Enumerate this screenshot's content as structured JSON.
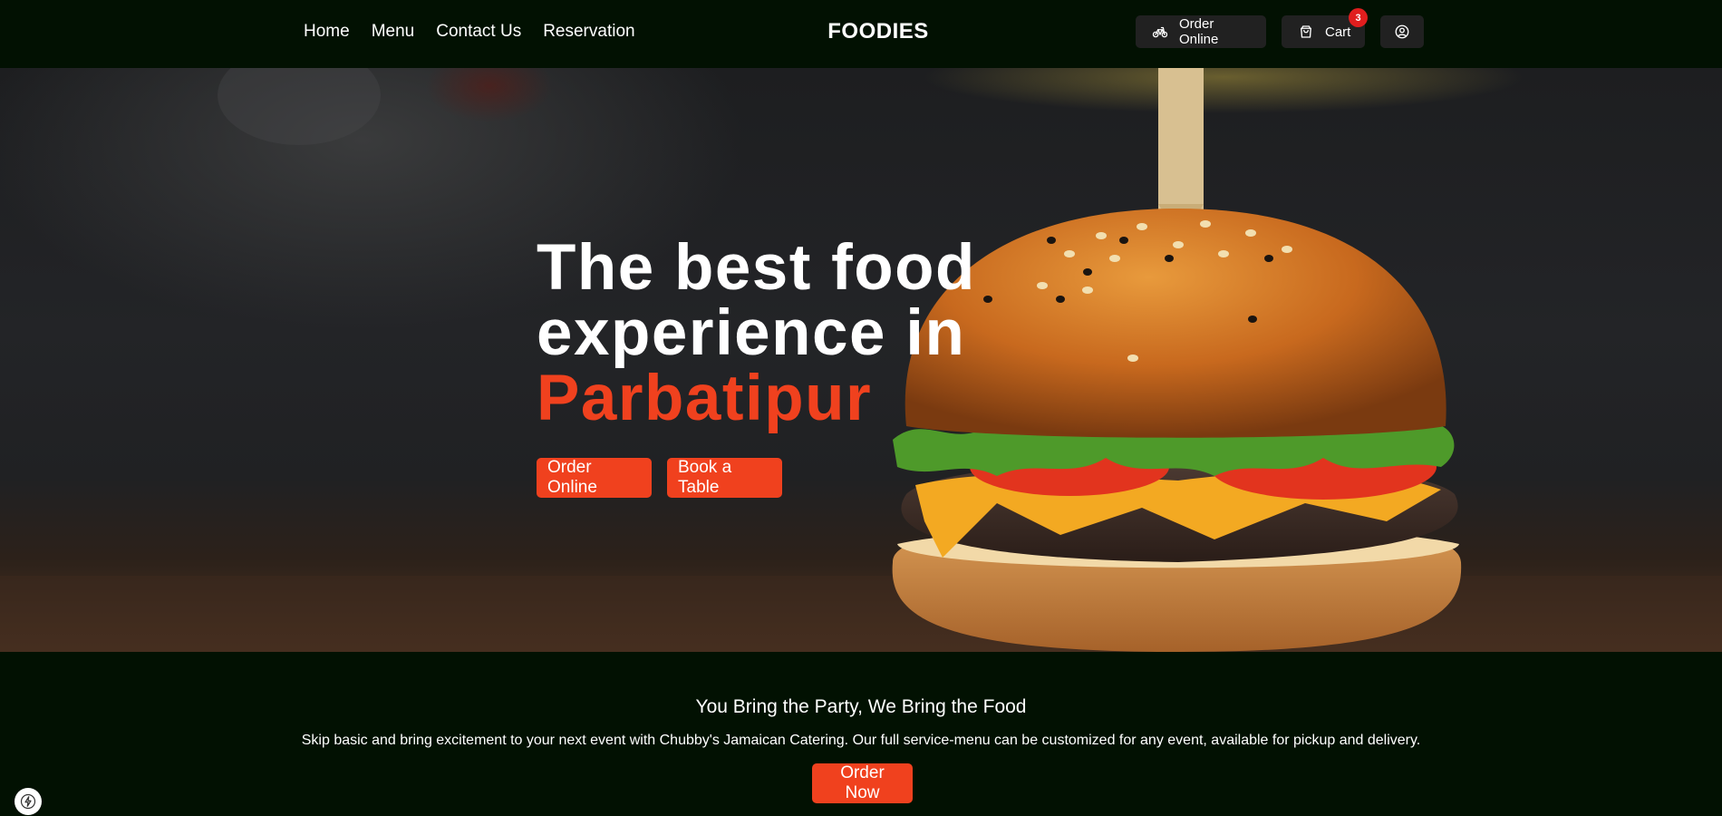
{
  "nav": {
    "links": [
      "Home",
      "Menu",
      "Contact Us",
      "Reservation"
    ],
    "brand": "FOODIES",
    "order_online_label": "Order Online",
    "cart_label": "Cart",
    "cart_count": "3",
    "icons": {
      "order": "bicycle-icon",
      "cart": "shopping-bag-icon",
      "profile": "user-circle-icon"
    }
  },
  "hero": {
    "title_line1": "The best food",
    "title_line2": "experience in",
    "title_accent": "Parbatipur",
    "primary_button": "Order Online",
    "secondary_button": "Book a Table"
  },
  "promo": {
    "title": "You Bring the Party, We Bring the Food",
    "text": "Skip basic and bring excitement to your next event with Chubby's Jamaican Catering. Our full service-menu can be customized for any event, available for pickup and delivery.",
    "button": "Order Now"
  },
  "colors": {
    "background": "#021102",
    "accent": "#f0411e",
    "nav_button": "#212121",
    "badge": "#e01e1e"
  },
  "corner_icon": "lightning-icon"
}
